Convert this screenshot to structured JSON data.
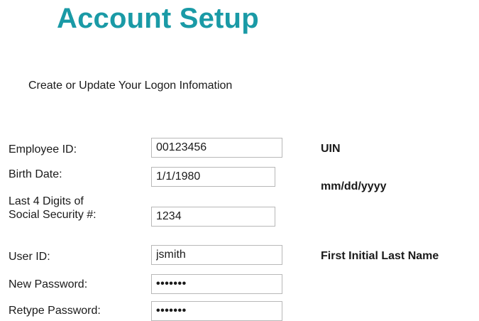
{
  "header": {
    "title": "Account Setup",
    "subtitle": "Create or Update Your Logon Infomation"
  },
  "form": {
    "employee_id": {
      "label": "Employee ID:",
      "value": "00123456",
      "hint": "UIN"
    },
    "birth_date": {
      "label": "Birth Date:",
      "value": "1/1/1980",
      "hint": "mm/dd/yyyy"
    },
    "ssn_last4": {
      "label_line1": "Last 4 Digits of",
      "label_line2": "Social Security #:",
      "value": "1234"
    },
    "user_id": {
      "label": "User ID:",
      "value": "jsmith",
      "hint": "First Initial Last Name"
    },
    "new_password": {
      "label": "New Password:",
      "value": "•••••••"
    },
    "retype_password": {
      "label": "Retype Password:",
      "value": "•••••••"
    }
  },
  "colors": {
    "title": "#1a9aa6",
    "input_border": "#b8b8b8"
  }
}
